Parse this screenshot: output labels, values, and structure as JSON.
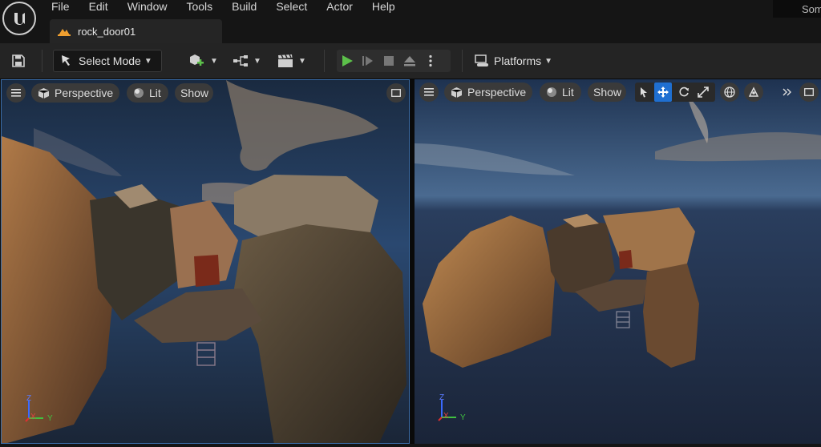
{
  "menu": [
    "File",
    "Edit",
    "Window",
    "Tools",
    "Build",
    "Select",
    "Actor",
    "Help"
  ],
  "search_partial": "Som",
  "document_tab": {
    "label": "rock_door01"
  },
  "toolbar": {
    "select_mode_label": "Select Mode",
    "platforms_label": "Platforms"
  },
  "viewports": {
    "left": {
      "perspective_label": "Perspective",
      "lit_label": "Lit",
      "show_label": "Show"
    },
    "right": {
      "perspective_label": "Perspective",
      "lit_label": "Lit",
      "show_label": "Show"
    }
  },
  "axes": {
    "z": "Z",
    "x": "X",
    "y": "Y"
  },
  "colors": {
    "play_green": "#5cc04a",
    "accent_blue": "#1f6fd1",
    "selection_border": "#3b6eaa"
  }
}
